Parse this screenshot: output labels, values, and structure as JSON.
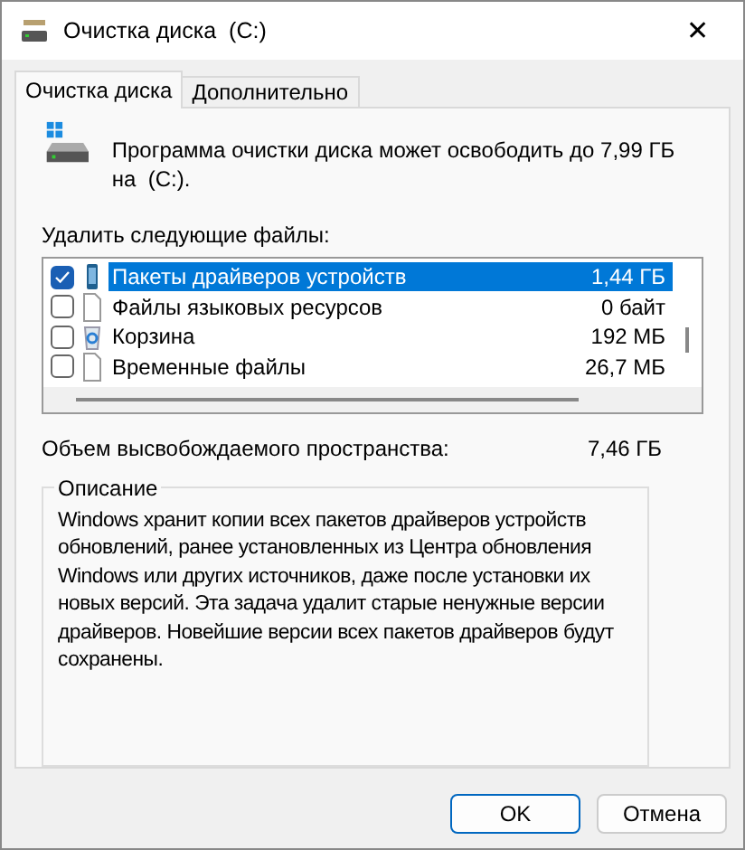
{
  "window": {
    "title": "Очистка диска  (C:)",
    "close": "✕"
  },
  "tabs": [
    {
      "label": "Очистка диска",
      "selected": true
    },
    {
      "label": "Дополнительно",
      "selected": false
    }
  ],
  "intro": "Программа очистки диска может освободить до 7,99 ГБ на  (C:).",
  "list_label": "Удалить следующие файлы:",
  "files": [
    {
      "name": "Пакеты драйверов устройств",
      "size": "1,44 ГБ",
      "checked": true,
      "selected": true,
      "kind": "driver"
    },
    {
      "name": "Файлы языковых ресурсов",
      "size": "0 байт",
      "checked": false,
      "selected": false,
      "kind": "file"
    },
    {
      "name": "Корзина",
      "size": "192 МБ",
      "checked": false,
      "selected": false,
      "kind": "bin"
    },
    {
      "name": "Временные файлы",
      "size": "26,7 МБ",
      "checked": false,
      "selected": false,
      "kind": "file"
    }
  ],
  "total": {
    "label": "Объем высвобождаемого пространства:",
    "value": "7,46 ГБ"
  },
  "description": {
    "title": "Описание",
    "text": "Windows хранит копии всех пакетов драйверов устройств обновлений, ранее установленных из Центра обновления Windows или других источников, даже после установки их новых версий. Эта задача удалит старые ненужные версии драйверов. Новейшие версии всех пакетов драйверов будут сохранены."
  },
  "buttons": [
    {
      "label": "OK",
      "default": true
    },
    {
      "label": "Отмена",
      "default": false
    }
  ]
}
